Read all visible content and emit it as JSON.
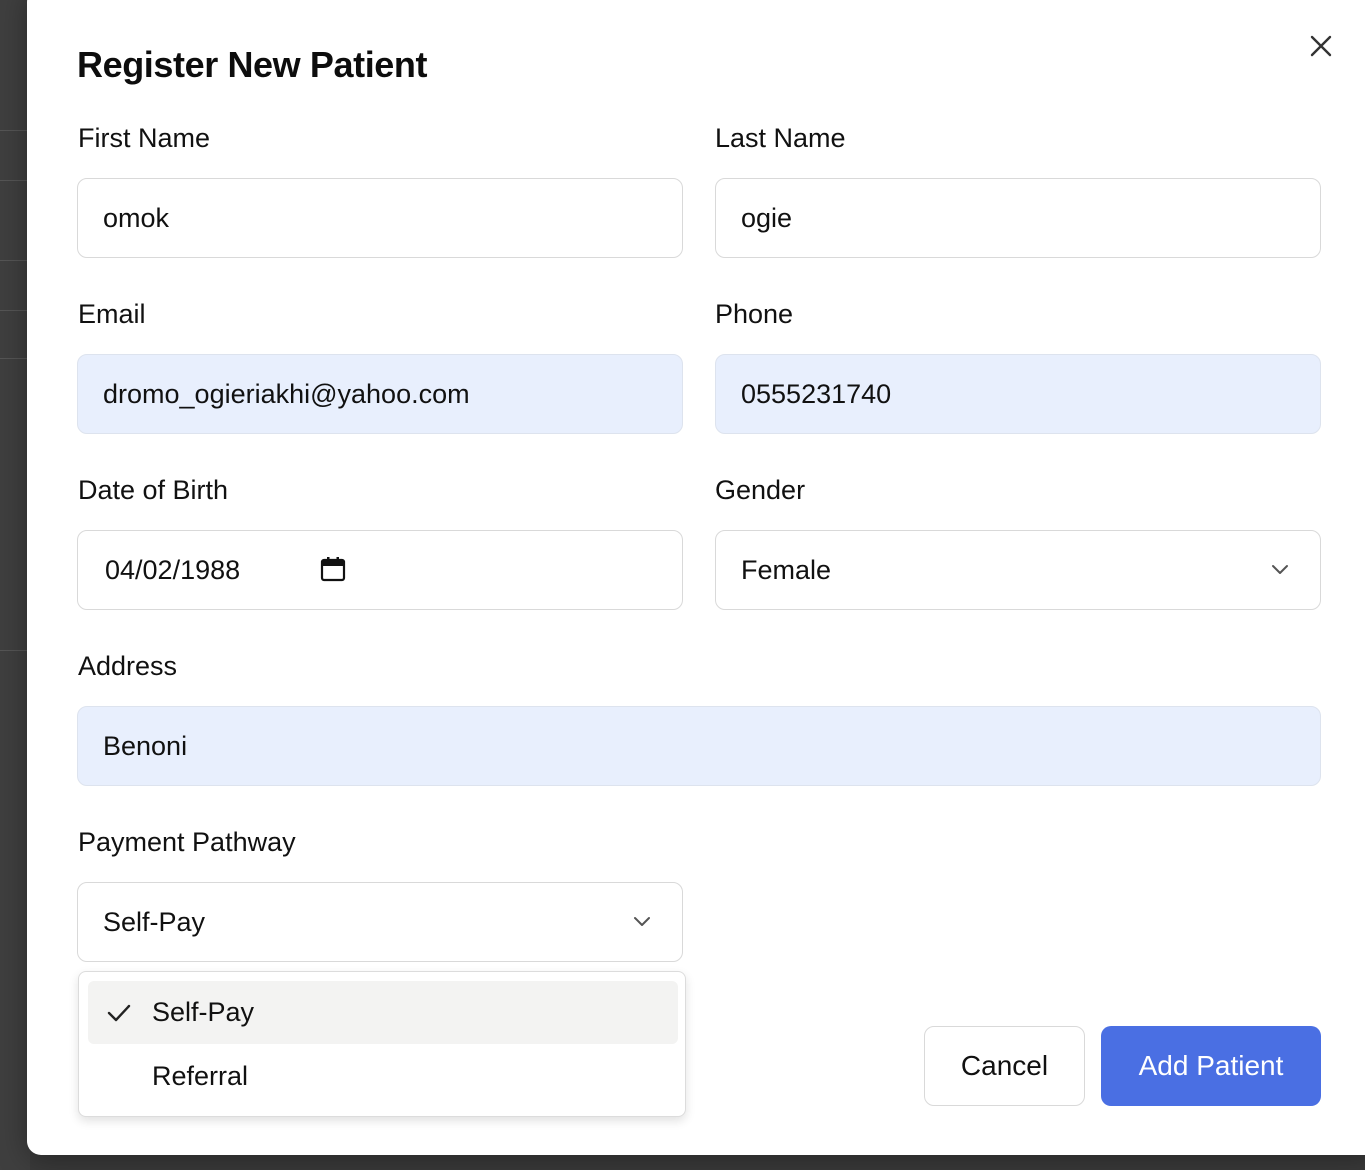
{
  "modal": {
    "title": "Register New Patient"
  },
  "form": {
    "first_name": {
      "label": "First Name",
      "value": "omok"
    },
    "last_name": {
      "label": "Last Name",
      "value": "ogie"
    },
    "email": {
      "label": "Email",
      "value": "dromo_ogieriakhi@yahoo.com"
    },
    "phone": {
      "label": "Phone",
      "value": "0555231740"
    },
    "dob": {
      "label": "Date of Birth",
      "value": "04/02/1988"
    },
    "gender": {
      "label": "Gender",
      "value": "Female"
    },
    "address": {
      "label": "Address",
      "value": "Benoni"
    },
    "payment": {
      "label": "Payment Pathway",
      "value": "Self-Pay",
      "options": [
        "Self-Pay",
        "Referral"
      ],
      "selected_index": 0
    }
  },
  "buttons": {
    "cancel": "Cancel",
    "submit": "Add Patient"
  },
  "colors": {
    "primary": "#4a6fe3",
    "autofill_bg": "#e8effd",
    "option_highlight": "#f3f3f2"
  },
  "icons": {
    "close": "close-icon",
    "calendar": "calendar-icon",
    "chevron": "chevron-down-icon",
    "check": "check-icon"
  }
}
